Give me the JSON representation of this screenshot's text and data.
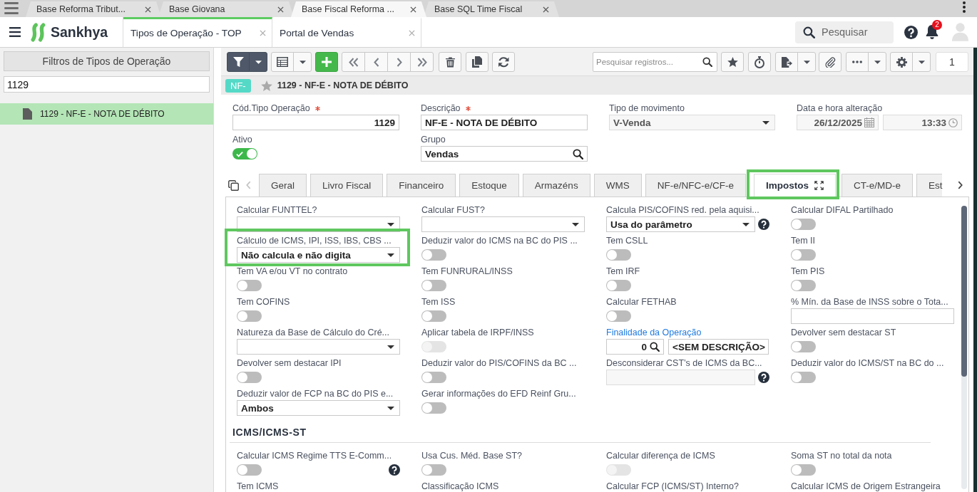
{
  "browser": {
    "tabs": [
      {
        "title": "Base Reforma Tribut...",
        "selected": false
      },
      {
        "title": "Base Giovana",
        "selected": false
      },
      {
        "title": "Base Fiscal Reforma ...",
        "selected": true
      },
      {
        "title": "Base SQL Time Fiscal",
        "selected": false
      }
    ]
  },
  "header": {
    "logo": "Sankhya",
    "tabs": [
      {
        "label": "Tipos de Operação - TOP",
        "selected": true
      },
      {
        "label": "Portal de Vendas",
        "selected": false
      }
    ],
    "search": {
      "placeholder": "Pesquisar"
    },
    "notifications": "2"
  },
  "sidebar": {
    "filter_button": "Filtros de Tipos de Operação",
    "search": {
      "value": "1129"
    },
    "items": [
      {
        "label": "1129 - NF-E - NOTA DE DÉBITO",
        "selected": true
      }
    ]
  },
  "toolbar": {
    "search": {
      "placeholder": "Pesquisar registros..."
    },
    "page": "1"
  },
  "record": {
    "badge": "NF-",
    "favorite": false,
    "title": "1129 - NF-E - NOTA DE DÉBITO"
  },
  "form": {
    "fields": [
      {
        "kind": "number",
        "label": "Cód.Tipo Operação",
        "required": true,
        "disabled": false,
        "value": "1129"
      },
      {
        "kind": "text",
        "label": "Descrição",
        "required": true,
        "disabled": false,
        "value": "NF-E - NOTA DE DÉBITO"
      },
      {
        "kind": "select",
        "label": "Tipo de movimento",
        "required": false,
        "disabled": true,
        "value": "V-Venda"
      },
      {
        "kind": "datetime",
        "label": "Data e hora alteração",
        "required": false,
        "disabled": true,
        "date": "26/12/2025",
        "time": "13:33"
      },
      {
        "kind": "toggle",
        "label": "Ativo",
        "required": false,
        "disabled": false,
        "on": true
      },
      {
        "kind": "lookup",
        "label": "Grupo",
        "required": false,
        "disabled": false,
        "value": "Vendas"
      }
    ]
  },
  "tabs": {
    "items": [
      {
        "label": "Geral",
        "selected": false,
        "highlighted": false
      },
      {
        "label": "Livro Fiscal",
        "selected": false,
        "highlighted": false
      },
      {
        "label": "Financeiro",
        "selected": false,
        "highlighted": false
      },
      {
        "label": "Estoque",
        "selected": false,
        "highlighted": false
      },
      {
        "label": "Armazéns",
        "selected": false,
        "highlighted": false
      },
      {
        "label": "WMS",
        "selected": false,
        "highlighted": false
      },
      {
        "label": "NF-e/NFC-e/CF-e",
        "selected": false,
        "highlighted": false
      },
      {
        "label": "Impostos",
        "selected": true,
        "highlighted": true
      },
      {
        "label": "CT-e/MD-e",
        "selected": false,
        "highlighted": false
      },
      {
        "label": "Est",
        "selected": false,
        "highlighted": false
      }
    ]
  },
  "tax": {
    "fields": [
      {
        "kind": "select",
        "label": "Calcular FUNTTEL?",
        "disabled": false,
        "help": false,
        "highlighted": false
      },
      {
        "kind": "select",
        "label": "Calcular FUST?",
        "disabled": false,
        "help": false,
        "highlighted": false
      },
      {
        "kind": "select",
        "label": "Calcula PIS/COFINS red. pela aquisi...",
        "disabled": false,
        "help": true,
        "highlighted": false,
        "value": "Usa do parâmetro"
      },
      {
        "kind": "toggle",
        "label": "Calcular DIFAL Partilhado",
        "disabled": false,
        "help": false,
        "highlighted": false,
        "on": false
      },
      {
        "kind": "select",
        "label": "Cálculo de ICMS, IPI, ISS, IBS, CBS ...",
        "disabled": false,
        "help": false,
        "highlighted": true,
        "value": "Não calcula e não digita"
      },
      {
        "kind": "toggle",
        "label": "Deduzir valor do ICMS na BC do PIS ...",
        "disabled": false,
        "help": false,
        "highlighted": false,
        "on": false
      },
      {
        "kind": "toggle",
        "label": "Tem CSLL",
        "disabled": false,
        "help": false,
        "highlighted": false,
        "on": false
      },
      {
        "kind": "toggle",
        "label": "Tem II",
        "disabled": false,
        "help": false,
        "highlighted": false,
        "on": false
      },
      {
        "kind": "toggle",
        "label": "Tem VA e/ou VT no contrato",
        "disabled": false,
        "help": false,
        "highlighted": false,
        "on": false
      },
      {
        "kind": "toggle",
        "label": "Tem FUNRURAL/INSS",
        "disabled": false,
        "help": false,
        "highlighted": false,
        "on": false
      },
      {
        "kind": "toggle",
        "label": "Tem IRF",
        "disabled": false,
        "help": false,
        "highlighted": false,
        "on": false
      },
      {
        "kind": "toggle",
        "label": "Tem PIS",
        "disabled": false,
        "help": false,
        "highlighted": false,
        "on": false
      },
      {
        "kind": "toggle",
        "label": "Tem COFINS",
        "disabled": false,
        "help": false,
        "highlighted": false,
        "on": false
      },
      {
        "kind": "toggle",
        "label": "Tem ISS",
        "disabled": false,
        "help": false,
        "highlighted": false,
        "on": false
      },
      {
        "kind": "toggle",
        "label": "Calcular FETHAB",
        "disabled": false,
        "help": false,
        "highlighted": false,
        "on": false
      },
      {
        "kind": "input",
        "label": "% Mín. da Base de INSS sobre o Tota...",
        "disabled": false,
        "help": false,
        "highlighted": false
      },
      {
        "kind": "select",
        "label": "Natureza da Base de Cálculo do Cré...",
        "disabled": false,
        "help": false,
        "highlighted": false
      },
      {
        "kind": "toggle",
        "label": "Aplicar tabela de IRPF/INSS",
        "disabled": true,
        "help": false,
        "highlighted": false,
        "on": false
      },
      {
        "kind": "code-lookup",
        "label": "Finalidade da Operação",
        "disabled": false,
        "help": false,
        "highlighted": false,
        "code": "0",
        "description": "<SEM DESCRIÇÃO>"
      },
      {
        "kind": "toggle",
        "label": "Devolver sem destacar ST",
        "disabled": false,
        "help": false,
        "highlighted": false,
        "on": false
      },
      {
        "kind": "toggle",
        "label": "Devolver sem destacar IPI",
        "disabled": false,
        "help": false,
        "highlighted": false,
        "on": false
      },
      {
        "kind": "toggle",
        "label": "Deduzir valor do PIS/COFINS da BC ...",
        "disabled": false,
        "help": false,
        "highlighted": false,
        "on": false
      },
      {
        "kind": "input",
        "label": "Desconsiderar CST’s de ICMS da BC...",
        "disabled": true,
        "help": true,
        "highlighted": false
      },
      {
        "kind": "toggle",
        "label": "Deduzir valor do ICMS/ST na BC do ...",
        "disabled": false,
        "help": false,
        "highlighted": false,
        "on": false
      },
      {
        "kind": "select",
        "label": "Deduzir valor de FCP na BC do PIS e...",
        "disabled": false,
        "help": false,
        "highlighted": false,
        "value": "Ambos"
      },
      {
        "kind": "toggle",
        "label": "Gerar informações do EFD Reinf Gru...",
        "disabled": false,
        "help": false,
        "highlighted": false,
        "on": false
      }
    ],
    "sections": [
      {
        "title": "ICMS/ICMS-ST",
        "fields": [
          {
            "kind": "toggle",
            "label": "Calcular ICMS Regime TTS E-Comm...",
            "disabled": false,
            "help": true,
            "highlighted": false,
            "on": false
          },
          {
            "kind": "toggle",
            "label": "Usa Cus. Méd. Base ST?",
            "disabled": false,
            "help": false,
            "highlighted": false,
            "on": false
          },
          {
            "kind": "toggle",
            "label": "Calcular diferença de ICMS",
            "disabled": true,
            "help": false,
            "highlighted": false,
            "on": false
          },
          {
            "kind": "toggle",
            "label": "Soma ST no total da nota",
            "disabled": false,
            "help": false,
            "highlighted": false,
            "on": false
          },
          {
            "kind": "label",
            "label": "Tem ICMS",
            "help": false,
            "highlighted": false
          },
          {
            "kind": "label",
            "label": "Classificação ICMS",
            "help": false,
            "highlighted": false
          },
          {
            "kind": "label",
            "label": "Calcular FCP (ICMS/ST) Interno?",
            "help": false,
            "highlighted": false
          },
          {
            "kind": "label",
            "label": "Calcular ICMS de Origem Estrangeira",
            "help": false,
            "highlighted": false
          }
        ]
      }
    ]
  }
}
